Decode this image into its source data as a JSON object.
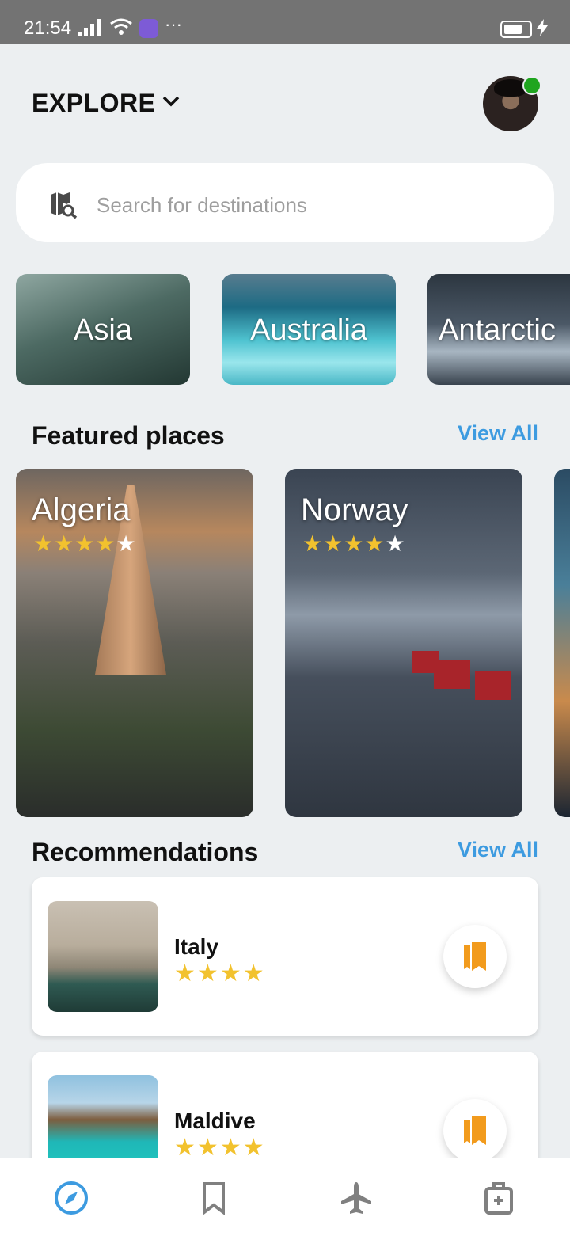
{
  "status_bar": {
    "time": "21:54",
    "dots": "···"
  },
  "header": {
    "title": "EXPLORE"
  },
  "search": {
    "placeholder": "Search for destinations"
  },
  "categories": [
    {
      "label": "Asia"
    },
    {
      "label": "Australia"
    },
    {
      "label": "Antarctic"
    }
  ],
  "featured": {
    "title": "Featured places",
    "view_all": "View All",
    "places": [
      {
        "name": "Algeria",
        "rating": 4.5
      },
      {
        "name": "Norway",
        "rating": 4.5
      }
    ]
  },
  "recommendations": {
    "title": "Recommendations",
    "view_all": "View All",
    "items": [
      {
        "name": "Italy",
        "rating": 4
      },
      {
        "name": "Maldive",
        "rating": 4
      }
    ]
  },
  "bottom_nav": {
    "items": [
      {
        "name": "explore",
        "icon": "compass-icon",
        "active": true
      },
      {
        "name": "saved",
        "icon": "bookmark-icon",
        "active": false
      },
      {
        "name": "flights",
        "icon": "airplane-icon",
        "active": false
      },
      {
        "name": "bag",
        "icon": "medical-bag-icon",
        "active": false
      }
    ]
  },
  "colors": {
    "accent": "#3d9be0",
    "star": "#f2c22e",
    "bookmark": "#f29b1d",
    "online": "#1fa51f",
    "background": "#eceff1"
  }
}
